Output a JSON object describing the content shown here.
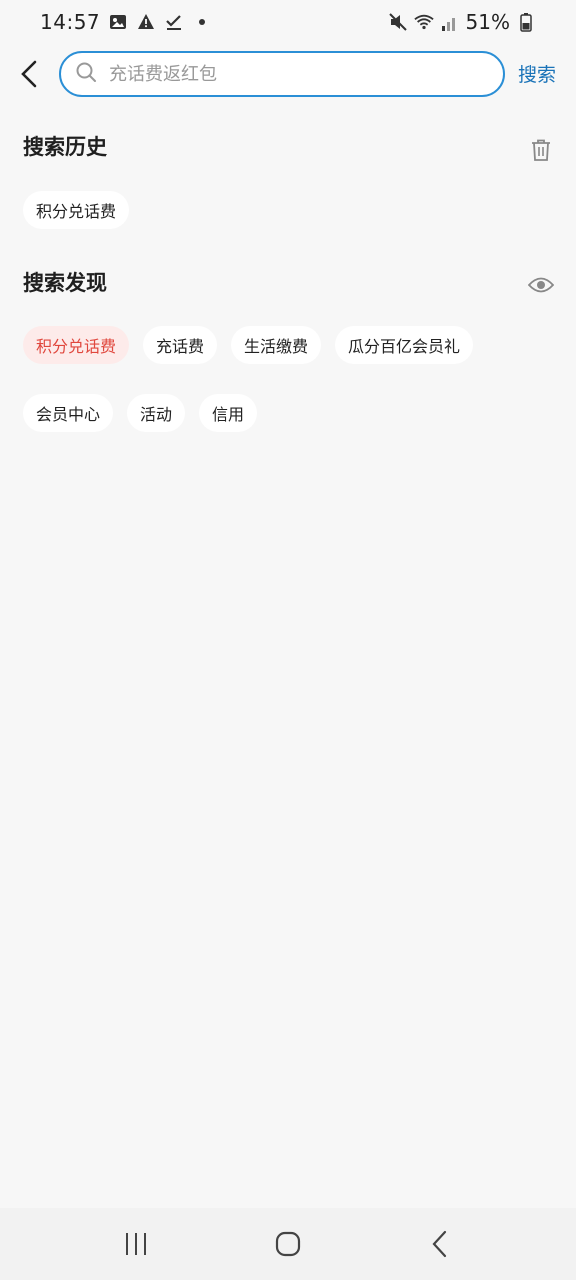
{
  "status_bar": {
    "time": "14:57",
    "icons_left": [
      "image-icon",
      "warning-icon",
      "check-icon",
      "dot-icon"
    ],
    "icons_right": [
      "mute-icon",
      "wifi-icon",
      "signal-icon",
      "battery-icon"
    ],
    "battery": "51%"
  },
  "header": {
    "search_placeholder": "充话费返红包",
    "search_button": "搜索"
  },
  "history": {
    "title": "搜索历史",
    "items": [
      "积分兑话费"
    ]
  },
  "discover": {
    "title": "搜索发现",
    "items": [
      {
        "label": "积分兑话费",
        "hot": true
      },
      {
        "label": "充话费",
        "hot": false
      },
      {
        "label": "生活缴费",
        "hot": false
      },
      {
        "label": "瓜分百亿会员礼",
        "hot": false
      },
      {
        "label": "会员中心",
        "hot": false
      },
      {
        "label": "活动",
        "hot": false
      },
      {
        "label": "信用",
        "hot": false
      }
    ]
  },
  "colors": {
    "accent": "#2b8fd6",
    "link": "#1a73b8",
    "hot_text": "#e0473d",
    "hot_bg": "#fdebea",
    "page_bg": "#f7f7f7"
  }
}
